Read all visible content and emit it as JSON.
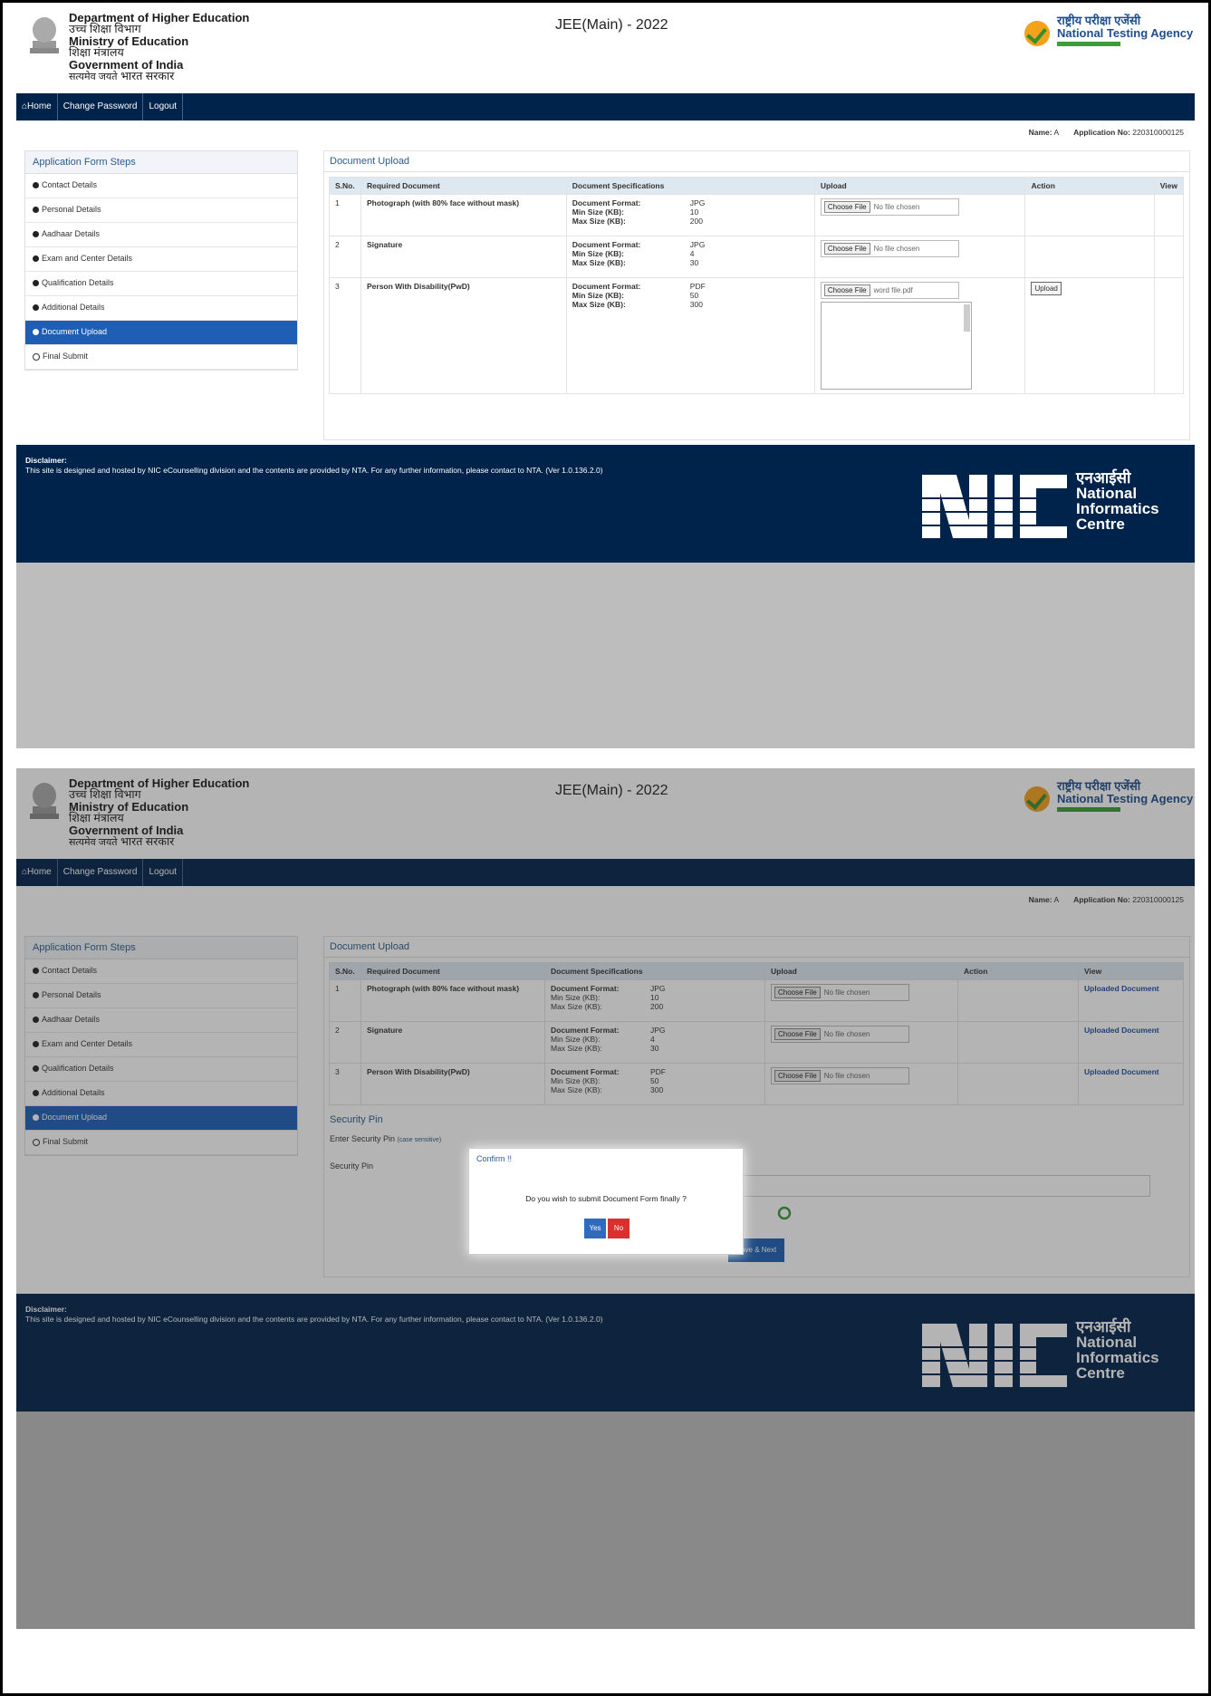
{
  "header": {
    "dept_title": "Department of Higher Education",
    "dept_hindi": "उच्च शिक्षा विभाग",
    "ministry": "Ministry of Education",
    "ministry_hindi": "शिक्षा मंत्रालय",
    "govt": "Government of India",
    "govt_hindi": "भारत सरकार",
    "emblem_motto": "सत्यमेव जयते",
    "exam_title": "JEE(Main) - 2022",
    "nta_hindi": "राष्ट्रीय परीक्षा एजेंसी",
    "nta_english": "National Testing Agency"
  },
  "nav": {
    "home": "Home",
    "change_password": "Change Password",
    "logout": "Logout"
  },
  "user": {
    "name_label": "Name:",
    "name_value": "A",
    "app_label": "Application No:",
    "app_value": "220310000125"
  },
  "sidebar": {
    "title": "Application Form Steps",
    "items": [
      {
        "label": "Contact Details"
      },
      {
        "label": "Personal Details"
      },
      {
        "label": "Aadhaar Details"
      },
      {
        "label": "Exam and Center Details"
      },
      {
        "label": "Qualification Details"
      },
      {
        "label": "Additional Details"
      },
      {
        "label": "Document Upload"
      },
      {
        "label": "Final Submit"
      }
    ]
  },
  "doc_upload": {
    "title": "Document Upload",
    "columns": [
      "S.No.",
      "Required Document",
      "Document Specifications",
      "Upload",
      "Action",
      "View"
    ],
    "spec_labels": {
      "format": "Document Format:",
      "min": "Min Size (KB):",
      "max": "Max Size (KB):"
    },
    "choose_file": "Choose File",
    "no_file": "No file chosen",
    "upload_btn": "Upload",
    "view_link": "Uploaded Document",
    "rows": [
      {
        "sno": "1",
        "doc": "Photograph (with 80% face without mask)",
        "format": "JPG",
        "min": "10",
        "max": "200",
        "file1": "No file chosen"
      },
      {
        "sno": "2",
        "doc": "Signature",
        "format": "JPG",
        "min": "4",
        "max": "30",
        "file1": "No file chosen"
      },
      {
        "sno": "3",
        "doc": "Person With Disability(PwD)",
        "format": "PDF",
        "min": "50",
        "max": "300",
        "file1": "word file.pdf"
      }
    ]
  },
  "security": {
    "title": "Security Pin",
    "enter_label": "Enter Security Pin",
    "case_note": "(case sensitive)",
    "pin_label": "Security Pin",
    "save_next": "Save & Next"
  },
  "modal": {
    "title": "Confirm !!",
    "message": "Do you wish to submit Document Form finally ?",
    "yes": "Yes",
    "no": "No"
  },
  "footer": {
    "disclaimer_title": "Disclaimer:",
    "disclaimer_text": "This site is designed and hosted by NIC eCounselling division and the contents are provided by NTA. For any further information, please contact to NTA. (Ver 1.0.136.2.0)",
    "nic_hindi": "एनआईसी",
    "nic_line1": "National",
    "nic_line2": "Informatics",
    "nic_line3": "Centre"
  },
  "colors": {
    "navy": "#00234b",
    "accent": "#1e5fb5",
    "no_red": "#d9312e"
  }
}
